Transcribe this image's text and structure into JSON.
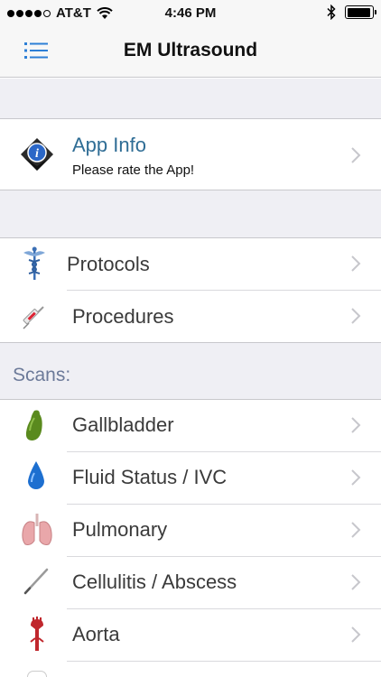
{
  "status_bar": {
    "carrier": "AT&T",
    "time": "4:46 PM",
    "battery_level": 0.95
  },
  "nav": {
    "title": "EM Ultrasound",
    "menu_icon": "list-menu-icon"
  },
  "app_info": {
    "title": "App Info",
    "subtitle": "Please rate the App!",
    "icon": "info-diamond-icon"
  },
  "tools": [
    {
      "label": "Protocols",
      "icon": "caduceus-icon"
    },
    {
      "label": "Procedures",
      "icon": "syringe-icon"
    }
  ],
  "scans": {
    "header": "Scans:",
    "items": [
      {
        "label": "Gallbladder",
        "icon": "gallbladder-icon"
      },
      {
        "label": "Fluid Status / IVC",
        "icon": "water-drop-icon"
      },
      {
        "label": "Pulmonary",
        "icon": "lungs-icon"
      },
      {
        "label": "Cellulitis / Abscess",
        "icon": "needle-icon"
      },
      {
        "label": "Aorta",
        "icon": "aorta-icon"
      }
    ]
  },
  "colors": {
    "link_blue": "#2f6d95",
    "section_header": "#6c7a99",
    "menu_blue": "#2d7fd6",
    "group_bg": "#efeff4"
  }
}
